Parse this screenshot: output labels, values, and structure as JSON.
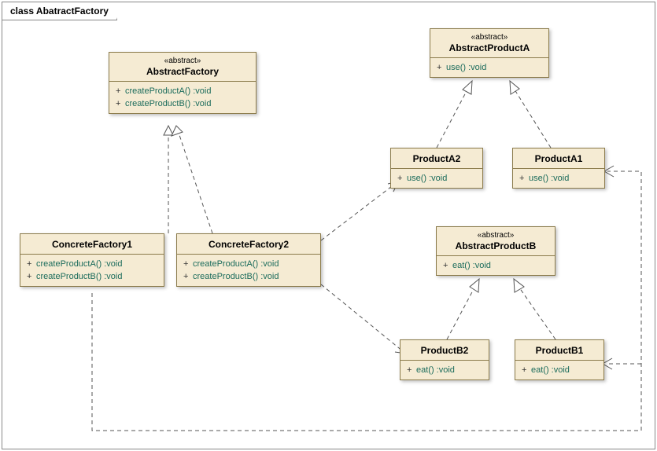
{
  "frame": {
    "title": "class AbatractFactory"
  },
  "classes": {
    "abstractFactory": {
      "stereotype": "«abstract»",
      "name": "AbstractFactory",
      "ops": [
        {
          "vis": "+",
          "sig": "createProductA()  :void"
        },
        {
          "vis": "+",
          "sig": "createProductB()  :void"
        }
      ]
    },
    "concreteFactory1": {
      "name": "ConcreteFactory1",
      "ops": [
        {
          "vis": "+",
          "sig": "createProductA()  :void"
        },
        {
          "vis": "+",
          "sig": "createProductB()  :void"
        }
      ]
    },
    "concreteFactory2": {
      "name": "ConcreteFactory2",
      "ops": [
        {
          "vis": "+",
          "sig": "createProductA()  :void"
        },
        {
          "vis": "+",
          "sig": "createProductB()  :void"
        }
      ]
    },
    "abstractProductA": {
      "stereotype": "«abstract»",
      "name": "AbstractProductA",
      "ops": [
        {
          "vis": "+",
          "sig": "use()  :void"
        }
      ]
    },
    "productA1": {
      "name": "ProductA1",
      "ops": [
        {
          "vis": "+",
          "sig": "use()  :void"
        }
      ]
    },
    "productA2": {
      "name": "ProductA2",
      "ops": [
        {
          "vis": "+",
          "sig": "use()  :void"
        }
      ]
    },
    "abstractProductB": {
      "stereotype": "«abstract»",
      "name": "AbstractProductB",
      "ops": [
        {
          "vis": "+",
          "sig": "eat()  :void"
        }
      ]
    },
    "productB1": {
      "name": "ProductB1",
      "ops": [
        {
          "vis": "+",
          "sig": "eat()  :void"
        }
      ]
    },
    "productB2": {
      "name": "ProductB2",
      "ops": [
        {
          "vis": "+",
          "sig": "eat()  :void"
        }
      ]
    }
  },
  "chart_data": {
    "type": "uml-class-diagram",
    "title": "class AbatractFactory",
    "classes": [
      {
        "id": "AbstractFactory",
        "abstract": true,
        "methods": [
          "+ createProductA() : void",
          "+ createProductB() : void"
        ]
      },
      {
        "id": "ConcreteFactory1",
        "abstract": false,
        "methods": [
          "+ createProductA() : void",
          "+ createProductB() : void"
        ]
      },
      {
        "id": "ConcreteFactory2",
        "abstract": false,
        "methods": [
          "+ createProductA() : void",
          "+ createProductB() : void"
        ]
      },
      {
        "id": "AbstractProductA",
        "abstract": true,
        "methods": [
          "+ use() : void"
        ]
      },
      {
        "id": "ProductA1",
        "abstract": false,
        "methods": [
          "+ use() : void"
        ]
      },
      {
        "id": "ProductA2",
        "abstract": false,
        "methods": [
          "+ use() : void"
        ]
      },
      {
        "id": "AbstractProductB",
        "abstract": true,
        "methods": [
          "+ eat() : void"
        ]
      },
      {
        "id": "ProductB1",
        "abstract": false,
        "methods": [
          "+ eat() : void"
        ]
      },
      {
        "id": "ProductB2",
        "abstract": false,
        "methods": [
          "+ eat() : void"
        ]
      }
    ],
    "relations": [
      {
        "from": "ConcreteFactory1",
        "to": "AbstractFactory",
        "kind": "realization"
      },
      {
        "from": "ConcreteFactory2",
        "to": "AbstractFactory",
        "kind": "realization"
      },
      {
        "from": "ProductA1",
        "to": "AbstractProductA",
        "kind": "realization"
      },
      {
        "from": "ProductA2",
        "to": "AbstractProductA",
        "kind": "realization"
      },
      {
        "from": "ProductB1",
        "to": "AbstractProductB",
        "kind": "realization"
      },
      {
        "from": "ProductB2",
        "to": "AbstractProductB",
        "kind": "realization"
      },
      {
        "from": "ConcreteFactory2",
        "to": "ProductA2",
        "kind": "dependency"
      },
      {
        "from": "ConcreteFactory2",
        "to": "ProductB2",
        "kind": "dependency"
      },
      {
        "from": "ConcreteFactory1",
        "to": "ProductA1",
        "kind": "dependency"
      },
      {
        "from": "ConcreteFactory1",
        "to": "ProductB1",
        "kind": "dependency"
      }
    ]
  }
}
